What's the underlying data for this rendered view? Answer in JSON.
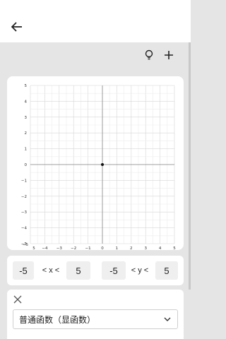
{
  "header": {
    "back_icon": "arrow-left-icon",
    "tools": [
      "lightbulb-icon",
      "plus-icon"
    ]
  },
  "graph": {
    "x_range": [
      -5,
      5
    ],
    "y_range": [
      -5,
      5
    ],
    "x_tick_labels": [
      "5",
      "−4",
      "−3",
      "−2",
      "−1",
      "0",
      "1",
      "2",
      "3",
      "4",
      "5"
    ],
    "y_tick_labels": [
      "5",
      "4",
      "3",
      "2",
      "1",
      "0",
      "−1",
      "−2",
      "−3",
      "−4",
      "−5"
    ],
    "corner_label": "−5",
    "points": [
      {
        "x": 0,
        "y": 0
      }
    ],
    "grid": true
  },
  "range": {
    "x_min": "-5",
    "x_label": "< x <",
    "x_max": "5",
    "y_min": "-5",
    "y_label": "< y <",
    "y_max": "5"
  },
  "function": {
    "type_select": "普通函数（显函数）"
  }
}
